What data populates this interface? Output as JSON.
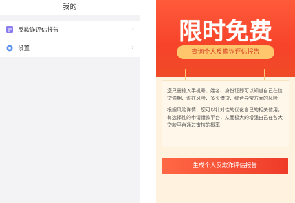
{
  "left": {
    "title": "我的",
    "items": [
      {
        "icon": "report-icon",
        "label": "反欺诈评估报告"
      },
      {
        "icon": "settings-icon",
        "label": "设置"
      }
    ]
  },
  "right": {
    "banner_title": "限时免费",
    "banner_button": "查询个人反欺诈评估报告",
    "paragraph1": "您只需输入手机号、姓名、身份证即可以知道自己在信贷逾期、潜在风险、多头借贷、综合异常方面的风险",
    "paragraph2": "根据风险详情，您可以针对性的优化自己的相关信用，有选择性的申请借款平台，从而极大的增强自己在各大贷款平台通过审核的概率",
    "generate_button": "生成个人反欺诈评估报告",
    "colors": {
      "accent": "#f6432a",
      "button_yellow": "#ffc66b",
      "card_bg": "#fff8ea"
    }
  }
}
